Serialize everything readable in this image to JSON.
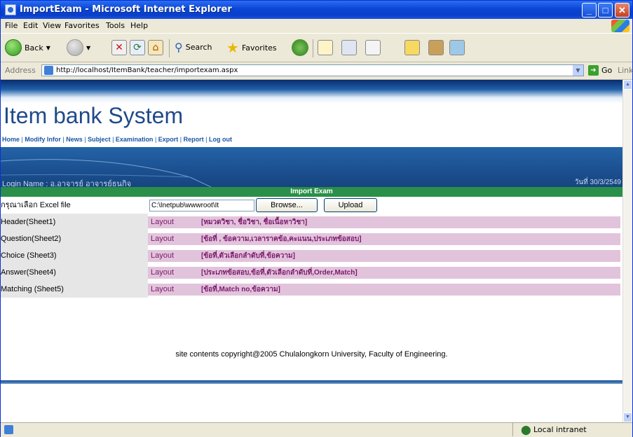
{
  "window": {
    "title": "ImportExam - Microsoft Internet Explorer"
  },
  "menu": [
    "File",
    "Edit",
    "View",
    "Favorites",
    "Tools",
    "Help"
  ],
  "toolbar": {
    "back": "Back",
    "search": "Search",
    "favorites": "Favorites"
  },
  "address": {
    "label": "Address",
    "url": "http://localhost/ItemBank/teacher/importexam.aspx",
    "go": "Go",
    "links": "Links"
  },
  "page": {
    "site_title": "Item bank System",
    "nav": [
      "Home",
      "Modify Infor",
      "News",
      "Subject",
      "Examination",
      "Export",
      "Report",
      "Log out"
    ],
    "login": "Login Name : อ.อาจารย์ อาจารย์ธนกิจ",
    "date": "วันที่ 30/3/2549",
    "section_title": "Import Exam",
    "file_label": "กรุณาเลือก Excel file",
    "file_value": "C:\\Inetpub\\wwwroot\\It",
    "browse": "Browse...",
    "upload": "Upload",
    "rows": [
      {
        "label": "Header(Sheet1)",
        "layout": "Layout",
        "spec": "[หมวดวิชา, ชื่อวิชา, ชื่อเนื้อหาวิชา]"
      },
      {
        "label": "Question(Sheet2)",
        "layout": "Layout",
        "spec": "[ข้อที่ , ข้อความ,เวลาราคข้อ,คะแนน,ประเภทข้อสอบ]"
      },
      {
        "label": "Choice (Sheet3)",
        "layout": "Layout",
        "spec": "[ข้อที่,ตัวเลือกลำดับที่,ข้อความ]"
      },
      {
        "label": "Answer(Sheet4)",
        "layout": "Layout",
        "spec": "[ประเภทข้อสอบ,ข้อที่,ตัวเลือกลำดับที่,Order,Match]"
      },
      {
        "label": "Matching (Sheet5)",
        "layout": "Layout",
        "spec": "[ข้อที่,Match no,ข้อความ]"
      }
    ],
    "copyright": "site contents copyright@2005 Chulalongkorn University, Faculty of Engineering."
  },
  "status": {
    "zone": "Local intranet"
  }
}
